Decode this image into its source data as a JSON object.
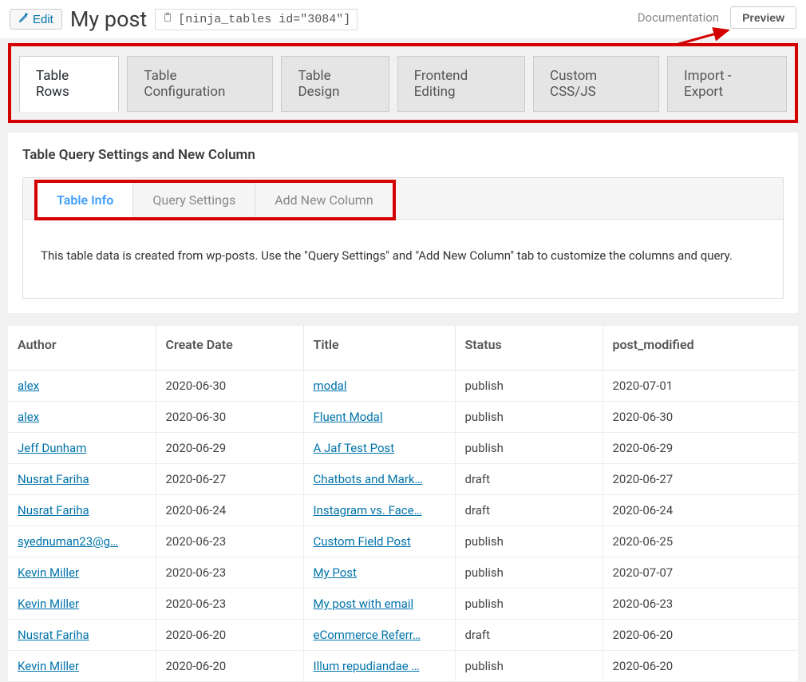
{
  "header": {
    "edit_label": "Edit",
    "page_title": "My post",
    "shortcode": "[ninja_tables id=\"3084\"]",
    "doc_link": "Documentation",
    "preview_label": "Preview"
  },
  "main_tabs": [
    {
      "label": "Table Rows",
      "active": true
    },
    {
      "label": "Table Configuration",
      "active": false
    },
    {
      "label": "Table Design",
      "active": false
    },
    {
      "label": "Frontend Editing",
      "active": false
    },
    {
      "label": "Custom CSS/JS",
      "active": false
    },
    {
      "label": "Import - Export",
      "active": false
    }
  ],
  "section": {
    "heading": "Table Query Settings and New Column",
    "sub_tabs": [
      {
        "label": "Table Info",
        "active": true
      },
      {
        "label": "Query Settings",
        "active": false
      },
      {
        "label": "Add New Column",
        "active": false
      }
    ],
    "info_text": "This table data is created from wp-posts. Use the \"Query Settings\" and \"Add New Column\" tab to customize the columns and query."
  },
  "table": {
    "headers": [
      "Author",
      "Create Date",
      "Title",
      "Status",
      "post_modified"
    ],
    "rows": [
      {
        "author": "alex",
        "create_date": "2020-06-30",
        "title": "modal",
        "status": "publish",
        "post_modified": "2020-07-01"
      },
      {
        "author": "alex",
        "create_date": "2020-06-30",
        "title": "Fluent Modal",
        "status": "publish",
        "post_modified": "2020-06-30"
      },
      {
        "author": "Jeff Dunham",
        "create_date": "2020-06-29",
        "title": "A Jaf Test Post",
        "status": "publish",
        "post_modified": "2020-06-29"
      },
      {
        "author": "Nusrat Fariha",
        "create_date": "2020-06-27",
        "title": "Chatbots and Mark…",
        "status": "draft",
        "post_modified": "2020-06-27"
      },
      {
        "author": "Nusrat Fariha",
        "create_date": "2020-06-24",
        "title": "Instagram vs. Face…",
        "status": "draft",
        "post_modified": "2020-06-24"
      },
      {
        "author": "syednuman23@g…",
        "create_date": "2020-06-23",
        "title": "Custom Field Post",
        "status": "publish",
        "post_modified": "2020-06-25"
      },
      {
        "author": "Kevin Miller",
        "create_date": "2020-06-23",
        "title": "My Post",
        "status": "publish",
        "post_modified": "2020-07-07"
      },
      {
        "author": "Kevin Miller",
        "create_date": "2020-06-23",
        "title": "My post with email",
        "status": "publish",
        "post_modified": "2020-06-23"
      },
      {
        "author": "Nusrat Fariha",
        "create_date": "2020-06-20",
        "title": "eCommerce Referr…",
        "status": "draft",
        "post_modified": "2020-06-20"
      },
      {
        "author": "Kevin Miller",
        "create_date": "2020-06-20",
        "title": "Illum repudiandae …",
        "status": "publish",
        "post_modified": "2020-06-20"
      }
    ]
  }
}
